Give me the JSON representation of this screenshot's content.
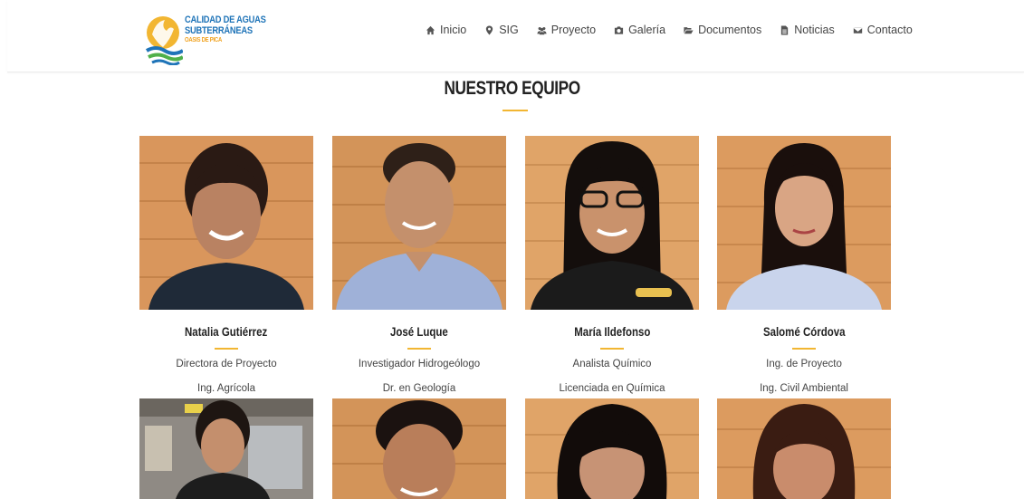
{
  "brand": {
    "line1": "CALIDAD DE AGUAS",
    "line2": "SUBTERRÁNEAS",
    "line3": "OASIS DE PICA"
  },
  "nav": [
    {
      "label": "Inicio",
      "icon": "home-icon"
    },
    {
      "label": "SIG",
      "icon": "map-marker-icon"
    },
    {
      "label": "Proyecto",
      "icon": "users-icon"
    },
    {
      "label": "Galería",
      "icon": "camera-icon"
    },
    {
      "label": "Documentos",
      "icon": "folder-open-icon"
    },
    {
      "label": "Noticias",
      "icon": "file-text-icon"
    },
    {
      "label": "Contacto",
      "icon": "envelope-icon"
    }
  ],
  "section": {
    "title": "NUESTRO EQUIPO"
  },
  "team": [
    {
      "name": "Natalia Gutiérrez",
      "role": "Directora de Proyecto",
      "degree": "Ing. Agrícola"
    },
    {
      "name": "José Luque",
      "role": "Investigador Hidrogeólogo",
      "degree": "Dr. en Geología"
    },
    {
      "name": "María Ildefonso",
      "role": "Analista Químico",
      "degree": "Licenciada en Química"
    },
    {
      "name": "Salomé Córdova",
      "role": "Ing. de Proyecto",
      "degree": "Ing. Civil Ambiental"
    }
  ],
  "colors": {
    "accent": "#f2b632",
    "brand_blue": "#1f74b8",
    "wood": "#d9965c"
  }
}
